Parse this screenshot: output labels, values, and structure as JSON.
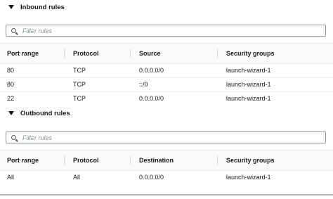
{
  "inbound": {
    "title": "Inbound rules",
    "filter_placeholder": "Filter rules",
    "headers": [
      "Port range",
      "Protocol",
      "Source",
      "Security groups"
    ],
    "rows": [
      [
        "80",
        "TCP",
        "0.0.0.0/0",
        "launch-wizard-1"
      ],
      [
        "80",
        "TCP",
        "::/0",
        "launch-wizard-1"
      ],
      [
        "22",
        "TCP",
        "0.0.0.0/0",
        "launch-wizard-1"
      ]
    ]
  },
  "outbound": {
    "title": "Outbound rules",
    "filter_placeholder": "Filter rules",
    "headers": [
      "Port range",
      "Protocol",
      "Destination",
      "Security groups"
    ],
    "rows": [
      [
        "All",
        "All",
        "0.0.0.0/0",
        "launch-wizard-1"
      ]
    ]
  }
}
